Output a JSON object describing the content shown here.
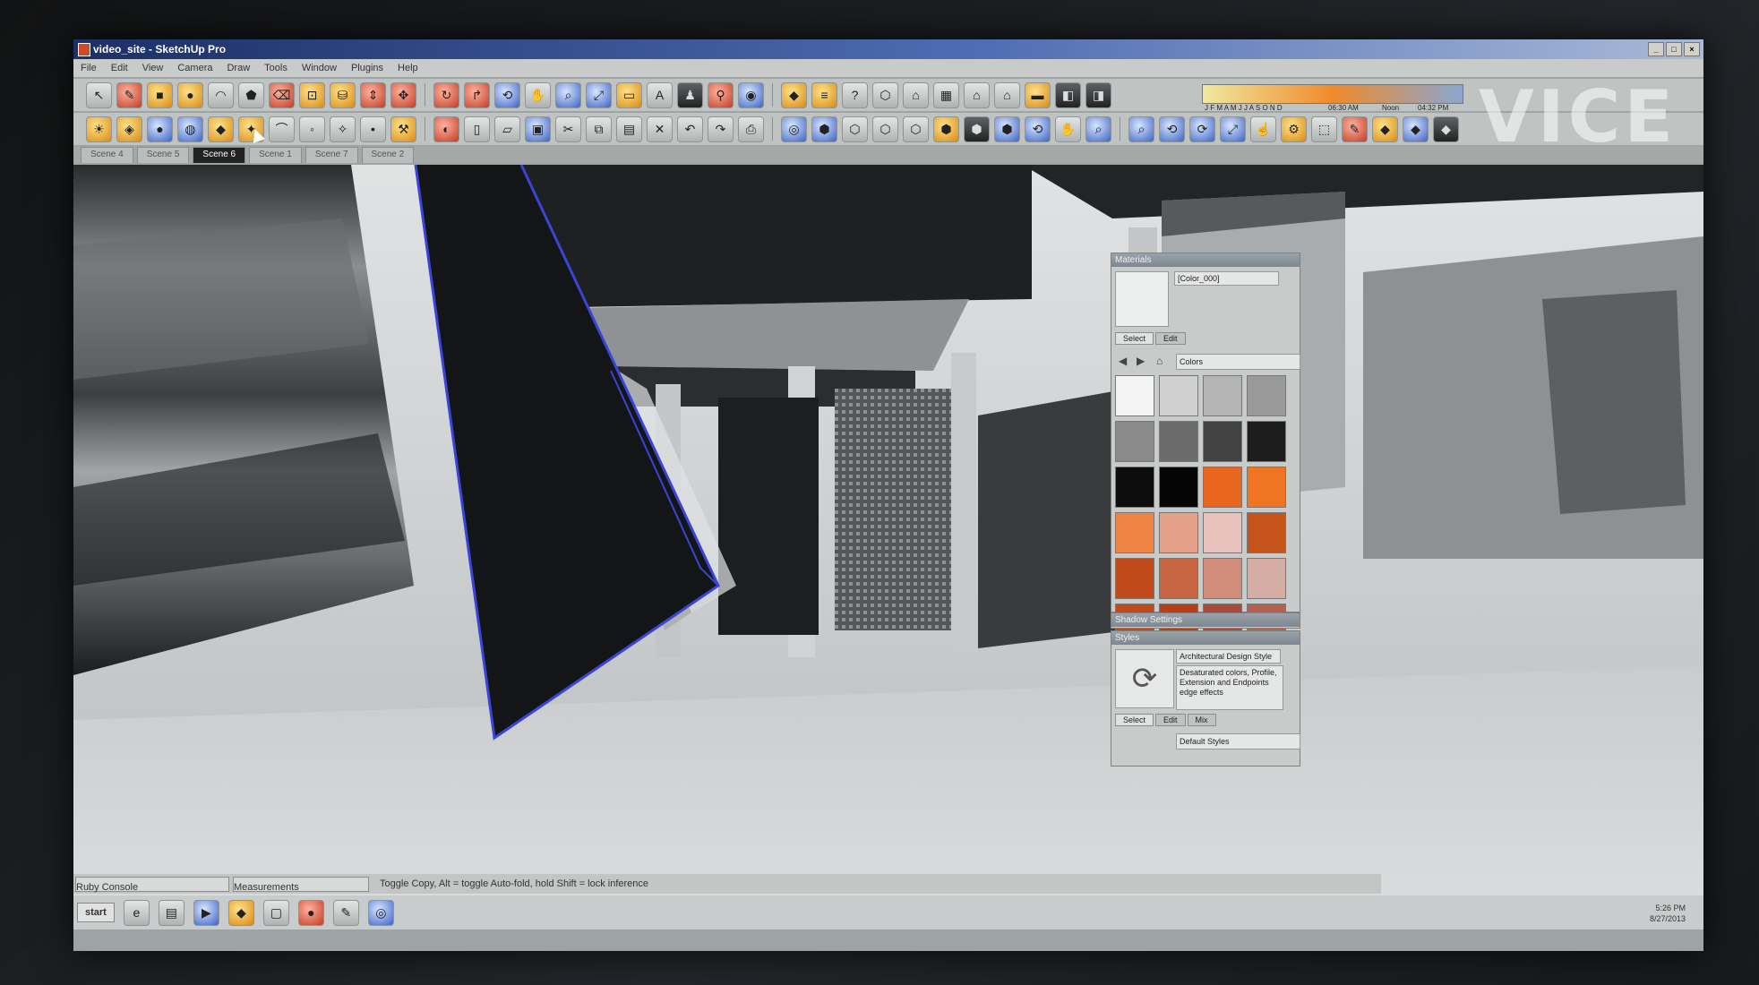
{
  "window": {
    "title": "video_site - SketchUp Pro",
    "controls": [
      "_",
      "□",
      "×"
    ]
  },
  "menu": [
    "File",
    "Edit",
    "View",
    "Camera",
    "Draw",
    "Tools",
    "Window",
    "Plugins",
    "Help"
  ],
  "toolbar": {
    "row1": [
      {
        "icon": "select-arrow-icon",
        "glyph": "↖",
        "tone": ""
      },
      {
        "icon": "pencil-icon",
        "glyph": "✎",
        "tone": "red"
      },
      {
        "icon": "rectangle-icon",
        "glyph": "■",
        "tone": "warm"
      },
      {
        "icon": "circle-icon",
        "glyph": "●",
        "tone": "warm"
      },
      {
        "icon": "arc-icon",
        "glyph": "◠",
        "tone": ""
      },
      {
        "icon": "polygon-icon",
        "glyph": "⬟",
        "tone": ""
      },
      {
        "icon": "eraser-icon",
        "glyph": "⌫",
        "tone": "red"
      },
      {
        "icon": "tape-measure-icon",
        "glyph": "⊡",
        "tone": "warm"
      },
      {
        "icon": "paint-bucket-icon",
        "glyph": "⛁",
        "tone": "warm"
      },
      {
        "icon": "push-pull-icon",
        "glyph": "⇕",
        "tone": "red"
      },
      {
        "icon": "move-icon",
        "glyph": "✥",
        "tone": "red"
      },
      {
        "icon": "rotate-icon",
        "glyph": "↻",
        "tone": "red"
      },
      {
        "icon": "follow-me-icon",
        "glyph": "↱",
        "tone": "red"
      },
      {
        "icon": "orbit-icon",
        "glyph": "⟲",
        "tone": "blue"
      },
      {
        "icon": "pan-icon",
        "glyph": "✋",
        "tone": ""
      },
      {
        "icon": "zoom-icon",
        "glyph": "⌕",
        "tone": "blue"
      },
      {
        "icon": "zoom-extents-icon",
        "glyph": "⤢",
        "tone": "blue"
      },
      {
        "icon": "section-plane-icon",
        "glyph": "▭",
        "tone": "warm"
      },
      {
        "icon": "text-icon",
        "glyph": "A",
        "tone": ""
      },
      {
        "icon": "walk-icon",
        "glyph": "♟",
        "tone": "dark"
      },
      {
        "icon": "position-camera-icon",
        "glyph": "⚲",
        "tone": "red"
      },
      {
        "icon": "look-around-icon",
        "glyph": "◉",
        "tone": "blue"
      },
      {
        "icon": "sandbox-icon",
        "glyph": "◆",
        "tone": "warm"
      },
      {
        "icon": "layers-icon",
        "glyph": "≡",
        "tone": "warm"
      },
      {
        "icon": "help-icon",
        "glyph": "?",
        "tone": ""
      },
      {
        "icon": "iso-view-icon",
        "glyph": "⬡",
        "tone": ""
      },
      {
        "icon": "front-view-icon",
        "glyph": "⌂",
        "tone": ""
      },
      {
        "icon": "top-view-icon",
        "glyph": "▦",
        "tone": ""
      },
      {
        "icon": "right-view-icon",
        "glyph": "⌂",
        "tone": ""
      },
      {
        "icon": "back-view-icon",
        "glyph": "⌂",
        "tone": ""
      },
      {
        "icon": "left-view-icon",
        "glyph": "▬",
        "tone": "warm"
      },
      {
        "icon": "shadows-icon",
        "glyph": "◧",
        "tone": "dark"
      },
      {
        "icon": "fog-icon",
        "glyph": "◨",
        "tone": "dark"
      }
    ],
    "row2": [
      {
        "icon": "sun-icon",
        "glyph": "☀",
        "tone": "warm"
      },
      {
        "icon": "component-icon",
        "glyph": "◈",
        "tone": "warm"
      },
      {
        "icon": "sphere-icon",
        "glyph": "●",
        "tone": "blue"
      },
      {
        "icon": "globe-icon",
        "glyph": "◍",
        "tone": "blue"
      },
      {
        "icon": "gem-icon",
        "glyph": "◆",
        "tone": "warm"
      },
      {
        "icon": "light-icon",
        "glyph": "✦",
        "tone": "warm"
      },
      {
        "icon": "lamp-icon",
        "glyph": "⌒",
        "tone": ""
      },
      {
        "icon": "spotlight-icon",
        "glyph": "◦",
        "tone": ""
      },
      {
        "icon": "render-icon",
        "glyph": "✧",
        "tone": ""
      },
      {
        "icon": "dot-icon",
        "glyph": "•",
        "tone": ""
      },
      {
        "icon": "hammer-icon",
        "glyph": "⚒",
        "tone": "warm"
      },
      {
        "icon": "color-wheel-icon",
        "glyph": "◐",
        "tone": "red"
      },
      {
        "icon": "new-file-icon",
        "glyph": "▯",
        "tone": ""
      },
      {
        "icon": "open-file-icon",
        "glyph": "▱",
        "tone": ""
      },
      {
        "icon": "save-icon",
        "glyph": "▣",
        "tone": "blue"
      },
      {
        "icon": "cut-icon",
        "glyph": "✂",
        "tone": ""
      },
      {
        "icon": "copy-icon",
        "glyph": "⧉",
        "tone": ""
      },
      {
        "icon": "paste-icon",
        "glyph": "▤",
        "tone": ""
      },
      {
        "icon": "delete-icon",
        "glyph": "✕",
        "tone": ""
      },
      {
        "icon": "undo-icon",
        "glyph": "↶",
        "tone": ""
      },
      {
        "icon": "redo-icon",
        "glyph": "↷",
        "tone": ""
      },
      {
        "icon": "print-icon",
        "glyph": "⎙",
        "tone": ""
      },
      {
        "icon": "model-info-icon",
        "glyph": "◎",
        "tone": "blue"
      },
      {
        "icon": "xray-icon",
        "glyph": "⬢",
        "tone": "blue"
      },
      {
        "icon": "back-edges-icon",
        "glyph": "⬡",
        "tone": ""
      },
      {
        "icon": "wireframe-icon",
        "glyph": "⬡",
        "tone": ""
      },
      {
        "icon": "hidden-line-icon",
        "glyph": "⬡",
        "tone": ""
      },
      {
        "icon": "shaded-icon",
        "glyph": "⬢",
        "tone": "warm"
      },
      {
        "icon": "shaded-textures-icon",
        "glyph": "⬢",
        "tone": "dark"
      },
      {
        "icon": "monochrome-icon",
        "glyph": "⬢",
        "tone": "blue"
      },
      {
        "icon": "orbit-2-icon",
        "glyph": "⟲",
        "tone": "blue"
      },
      {
        "icon": "pan-2-icon",
        "glyph": "✋",
        "tone": ""
      },
      {
        "icon": "zoom-2-icon",
        "glyph": "⌕",
        "tone": "blue"
      },
      {
        "icon": "zoom-window-icon",
        "glyph": "⌕",
        "tone": "blue"
      },
      {
        "icon": "previous-view-icon",
        "glyph": "⟲",
        "tone": "blue"
      },
      {
        "icon": "next-view-icon",
        "glyph": "⟳",
        "tone": "blue"
      },
      {
        "icon": "zoom-extents-2-icon",
        "glyph": "⤢",
        "tone": "blue"
      },
      {
        "icon": "interact-icon",
        "glyph": "☝",
        "tone": ""
      },
      {
        "icon": "dynamic-component-icon",
        "glyph": "⚙",
        "tone": "warm"
      },
      {
        "icon": "tool-x-icon",
        "glyph": "⬚",
        "tone": ""
      },
      {
        "icon": "paint-icon",
        "glyph": "✎",
        "tone": "red"
      },
      {
        "icon": "plugin-a-icon",
        "glyph": "◆",
        "tone": "warm"
      },
      {
        "icon": "plugin-b-icon",
        "glyph": "◆",
        "tone": "blue"
      },
      {
        "icon": "plugin-c-icon",
        "glyph": "◆",
        "tone": "dark"
      }
    ]
  },
  "shadow_bar": {
    "months": "J F M A M J J A S O N D",
    "time_am": "06:30 AM",
    "noon": "Noon",
    "time_pm": "04:32 PM"
  },
  "watermark": "VICE",
  "scene_tabs": [
    {
      "label": "Scene 4",
      "active": false
    },
    {
      "label": "Scene 5",
      "active": false
    },
    {
      "label": "Scene 6",
      "active": true
    },
    {
      "label": "Scene 1",
      "active": false
    },
    {
      "label": "Scene 7",
      "active": false
    },
    {
      "label": "Scene 2",
      "active": false
    }
  ],
  "status": {
    "hint": "Toggle Copy, Alt = toggle Auto-fold, hold Shift = lock inference",
    "box1": "Ruby Console",
    "box2": "Measurements"
  },
  "materials": {
    "title": "Materials",
    "current": "[Color_000]",
    "tabs": [
      "Select",
      "Edit"
    ],
    "library": "Colors",
    "swatches": [
      "#f3f3f3",
      "#cfcfcf",
      "#b4b4b4",
      "#9a9a9a",
      "#8a8a8a",
      "#6b6b6b",
      "#424242",
      "#1d1d1d",
      "#0d0d0d",
      "#050505",
      "#e8661e",
      "#ef7522",
      "#ef8545",
      "#e4a18a",
      "#e8c3bd",
      "#c4531c",
      "#c04a1a",
      "#c76442",
      "#cf8d7a",
      "#d6ada5",
      "#c14a18",
      "#b73f16",
      "#a94a3a",
      "#b46050"
    ]
  },
  "shadow_settings": {
    "title": "Shadow Settings"
  },
  "styles": {
    "title": "Styles",
    "current": "Architectural Design Style",
    "description": "Desaturated colors, Profile, Extension and Endpoints edge effects",
    "tabs": [
      "Select",
      "Edit",
      "Mix"
    ],
    "library": "Default Styles"
  },
  "taskbar": {
    "start": "start",
    "clock": "5:26 PM",
    "date": "8/27/2013"
  }
}
